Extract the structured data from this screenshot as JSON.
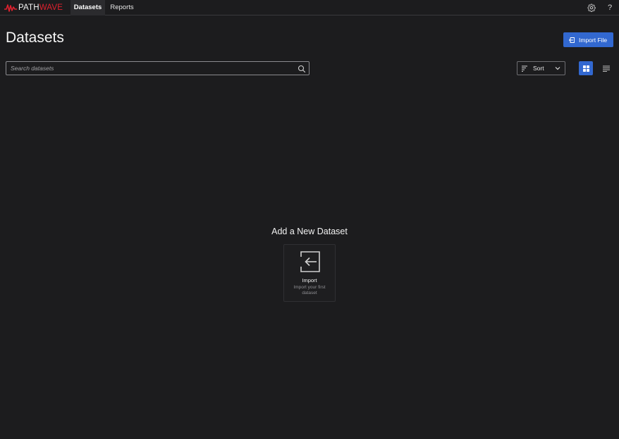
{
  "app": {
    "brand_part1": "PATH",
    "brand_part2": "WAVE",
    "brand_accent": "#e0212e"
  },
  "nav": {
    "tabs": [
      {
        "label": "Datasets",
        "active": true
      },
      {
        "label": "Reports",
        "active": false
      }
    ],
    "settings_icon": "gear-icon",
    "help_label": "?"
  },
  "page": {
    "title": "Datasets",
    "import_button": {
      "label": "Import File",
      "icon": "import-icon",
      "color": "#3268d0"
    }
  },
  "search": {
    "value": "",
    "placeholder": "Search datasets",
    "icon": "search-icon"
  },
  "toolbar": {
    "sort_label": "Sort",
    "sort_icon": "sort-icon",
    "view_modes": [
      {
        "name": "grid",
        "icon": "grid-icon",
        "active": true
      },
      {
        "name": "list",
        "icon": "list-icon",
        "active": false
      }
    ]
  },
  "empty_state": {
    "title": "Add a New Dataset",
    "card": {
      "title": "Import",
      "subtitle": "Import your first dataset",
      "icon": "import-icon"
    }
  }
}
